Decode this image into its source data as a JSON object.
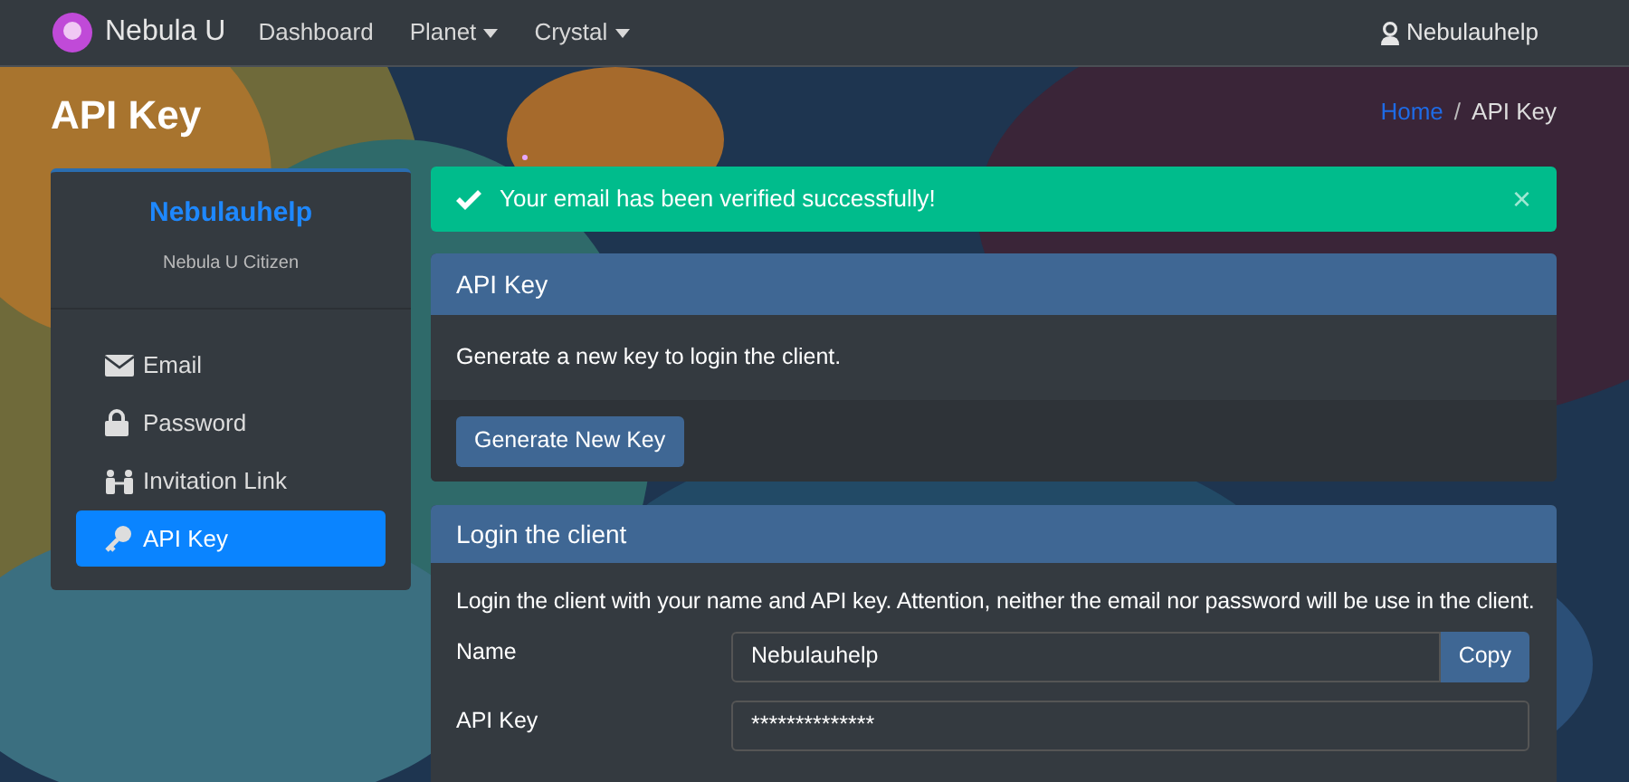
{
  "navbar": {
    "brand": "Nebula U",
    "links": [
      {
        "label": "Dashboard",
        "dropdown": false
      },
      {
        "label": "Planet",
        "dropdown": true
      },
      {
        "label": "Crystal",
        "dropdown": true
      }
    ],
    "user": "Nebulauhelp"
  },
  "page_title": "API Key",
  "breadcrumb": {
    "separator": "/",
    "items": [
      {
        "label": "Home",
        "link": true
      },
      {
        "label": "API Key",
        "link": false
      }
    ]
  },
  "profile": {
    "name": "Nebulauhelp",
    "role": "Nebula U Citizen"
  },
  "sidebar": {
    "items": [
      {
        "label": "Email",
        "selected": false
      },
      {
        "label": "Password",
        "selected": false
      },
      {
        "label": "Invitation Link",
        "selected": false
      },
      {
        "label": "API Key",
        "selected": true
      }
    ]
  },
  "alert": {
    "message": "Your email has been verified successfully!",
    "close": "×"
  },
  "api_key_card": {
    "title": "API Key",
    "text": "Generate a new key to login the client.",
    "button": "Generate New Key"
  },
  "login_card": {
    "title": "Login the client",
    "text": "Login the client with your name and API key. Attention, neither the email nor password will be use in the client.",
    "fields": [
      {
        "label": "Name",
        "value": "Nebulauhelp",
        "button": "Copy"
      },
      {
        "label": "API Key",
        "value": "**************"
      }
    ]
  }
}
